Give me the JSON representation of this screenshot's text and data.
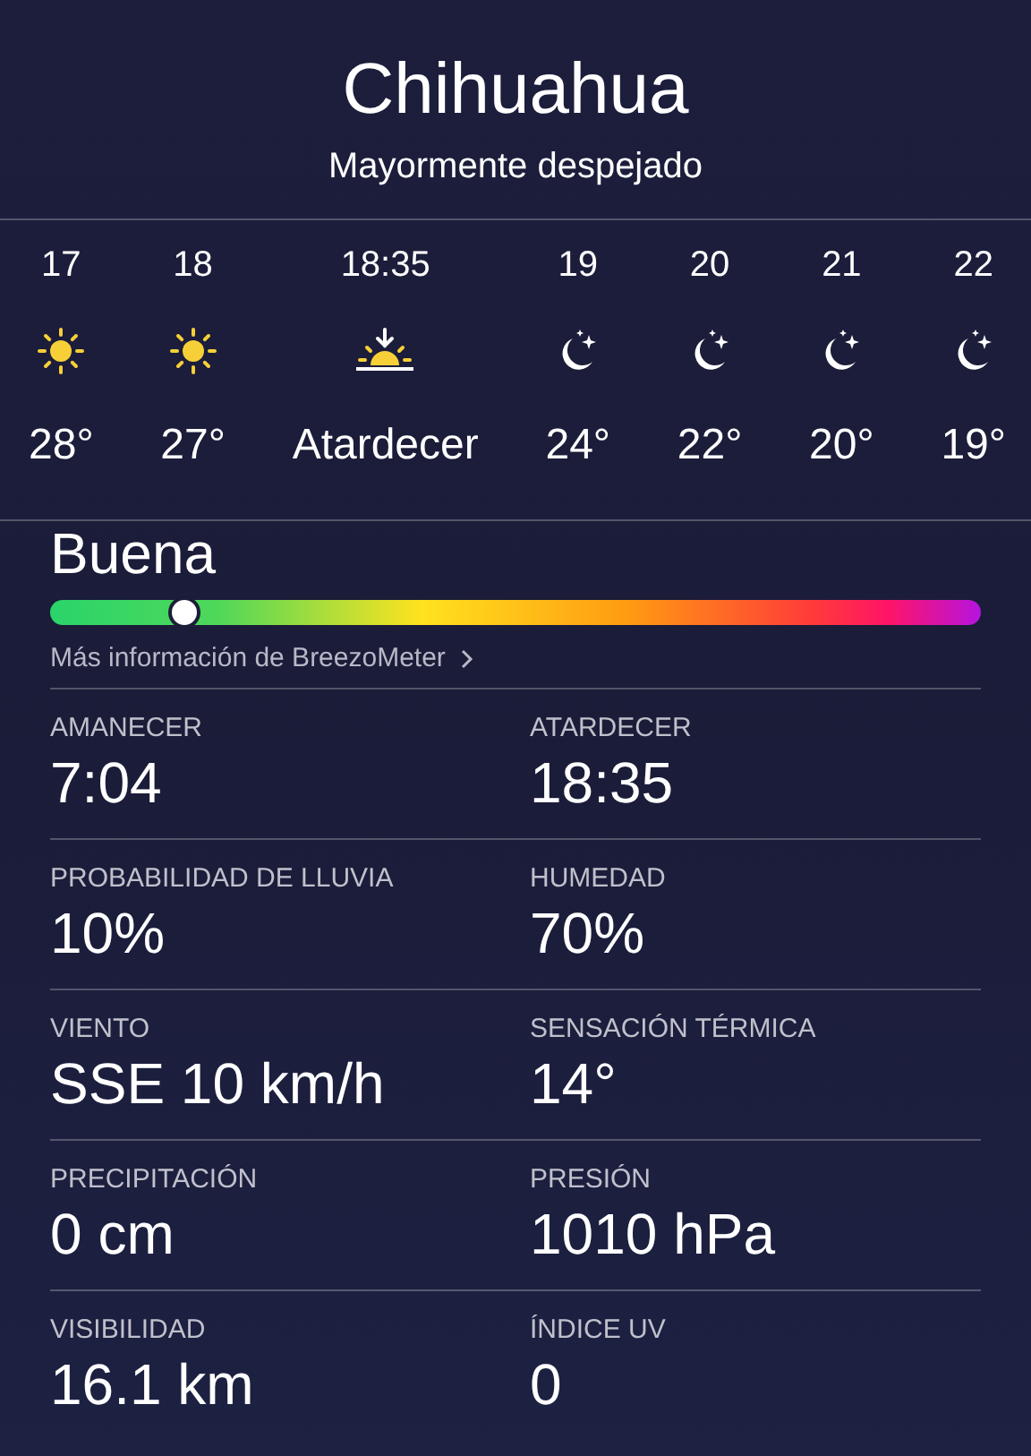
{
  "location": {
    "city": "Chihuahua",
    "condition": "Mayormente despejado"
  },
  "hourly": [
    {
      "time": "17",
      "kind": "sun",
      "temp": "28°"
    },
    {
      "time": "18",
      "kind": "sun",
      "temp": "27°"
    },
    {
      "time": "18:35",
      "kind": "sunset",
      "temp": "Atardecer"
    },
    {
      "time": "19",
      "kind": "moon",
      "temp": "24°"
    },
    {
      "time": "20",
      "kind": "moon",
      "temp": "22°"
    },
    {
      "time": "21",
      "kind": "moon",
      "temp": "20°"
    },
    {
      "time": "22",
      "kind": "moon",
      "temp": "19°"
    }
  ],
  "air_quality": {
    "label": "Buena",
    "level": 0.145,
    "link": "Más información de BreezoMeter"
  },
  "details": [
    {
      "label": "AMANECER",
      "value": "7:04"
    },
    {
      "label": "ATARDECER",
      "value": "18:35"
    },
    {
      "label": "PROBABILIDAD DE LLUVIA",
      "value": "10%"
    },
    {
      "label": "HUMEDAD",
      "value": "70%"
    },
    {
      "label": "VIENTO",
      "value": "SSE 10 km/h"
    },
    {
      "label": "SENSACIÓN TÉRMICA",
      "value": "14°"
    },
    {
      "label": "PRECIPITACIÓN",
      "value": "0 cm"
    },
    {
      "label": "PRESIÓN",
      "value": "1010 hPa"
    },
    {
      "label": "VISIBILIDAD",
      "value": "16.1 km"
    },
    {
      "label": "ÍNDICE UV",
      "value": "0"
    }
  ]
}
